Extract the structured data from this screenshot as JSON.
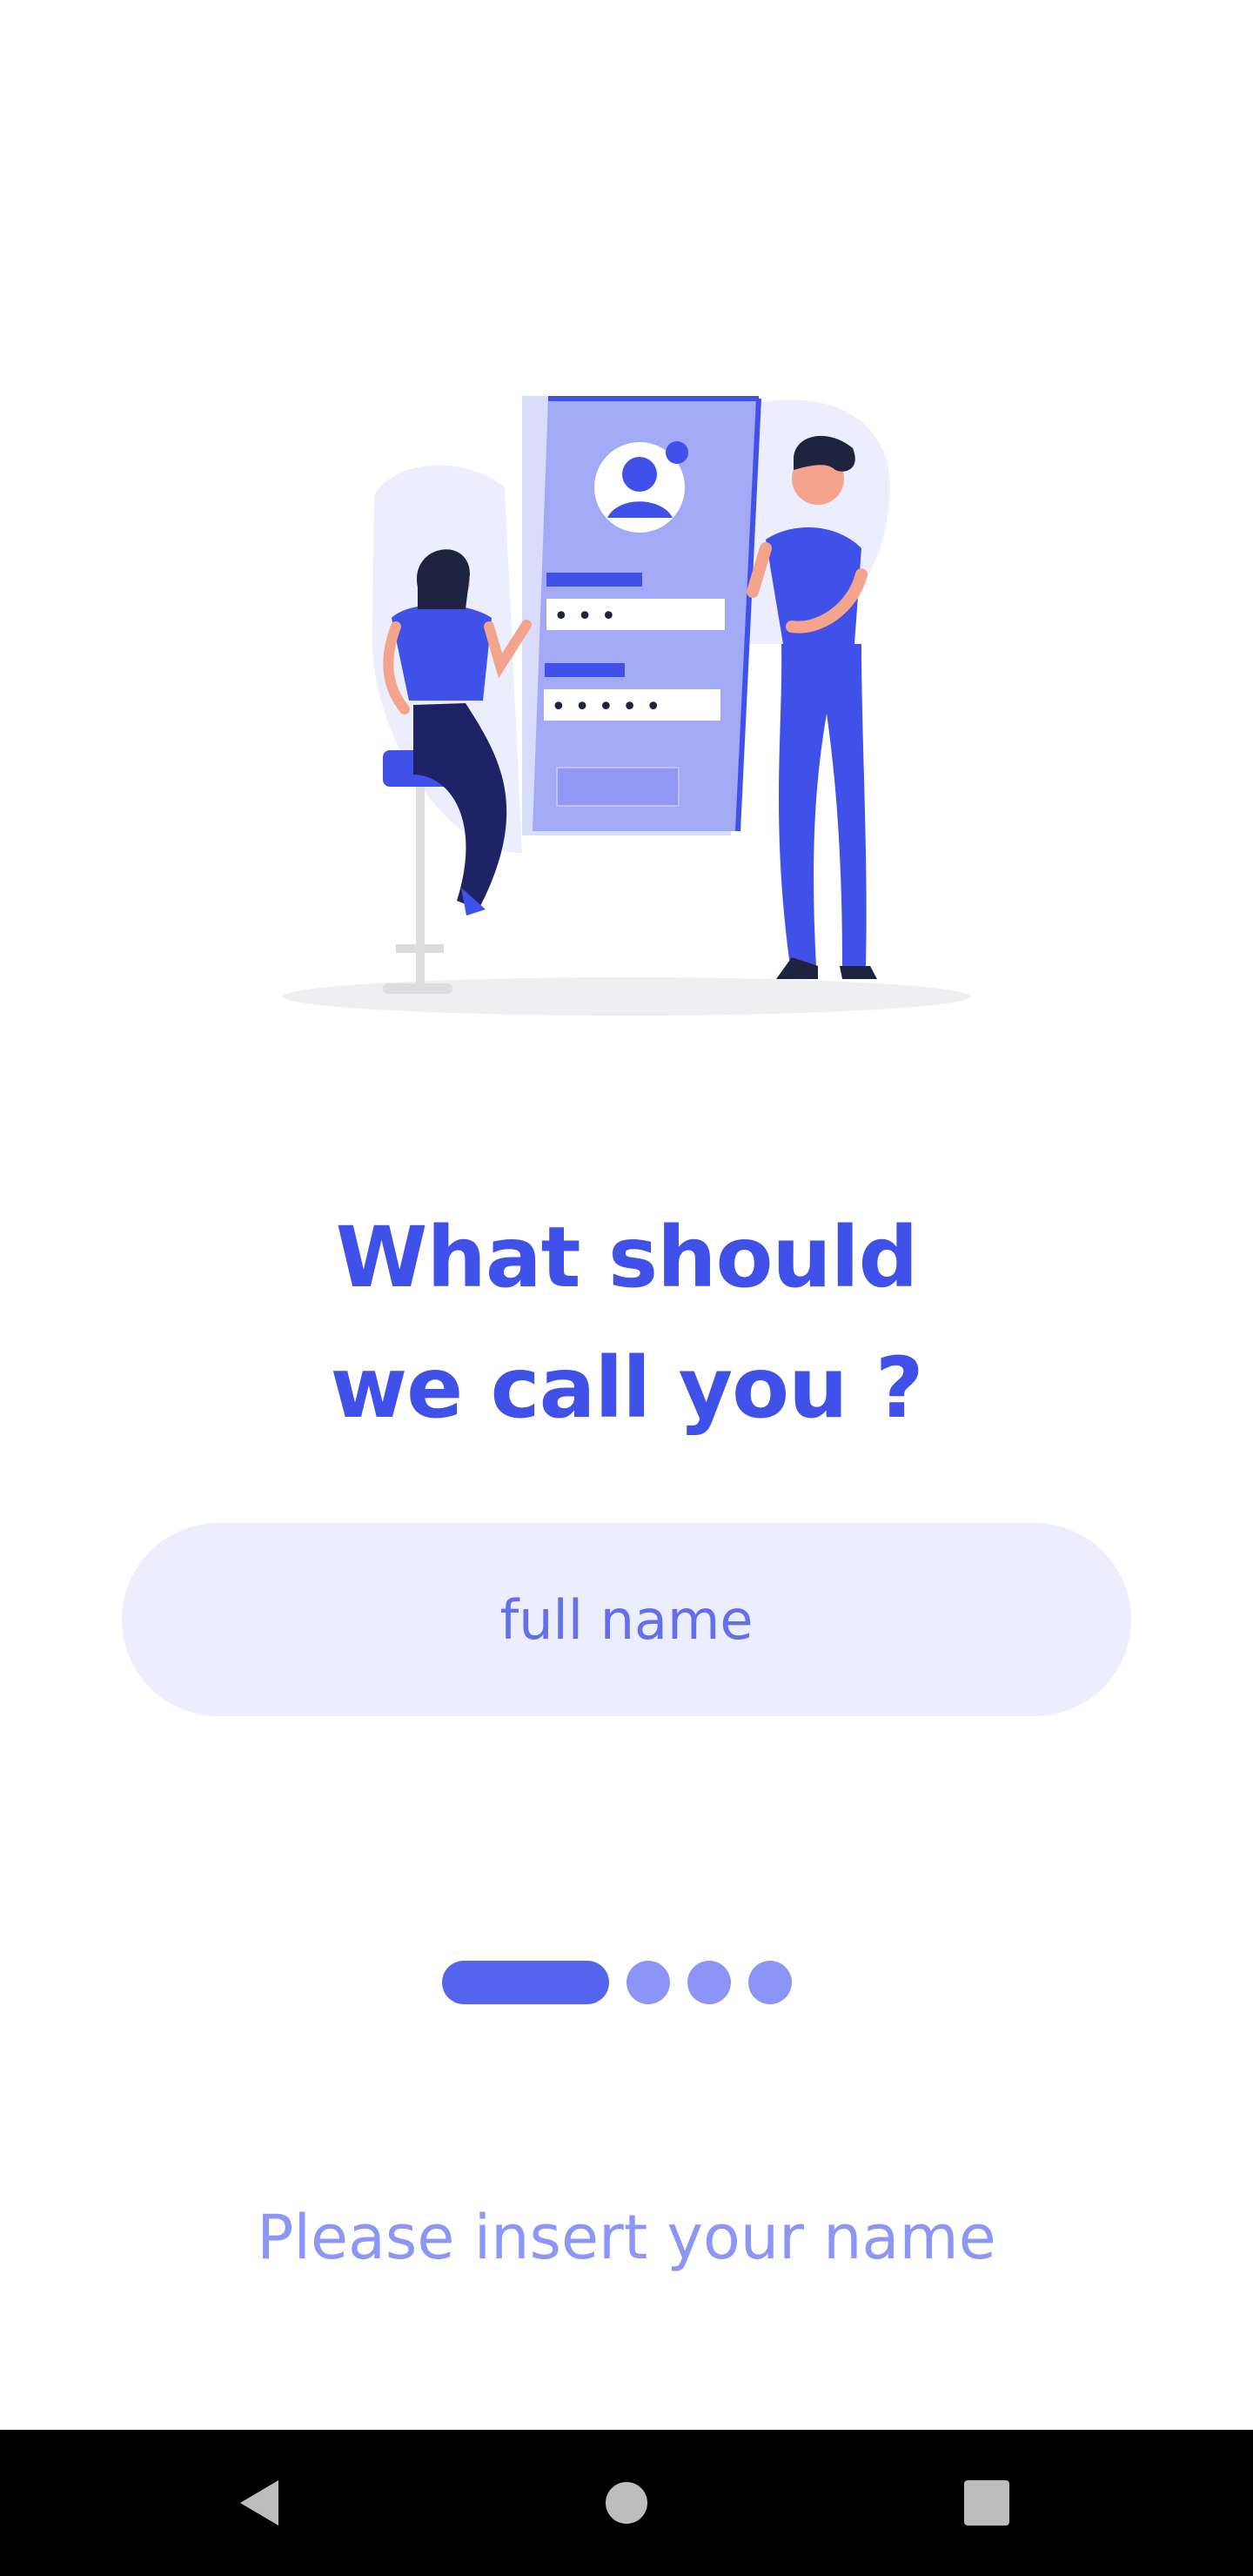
{
  "onboarding": {
    "title_line1": "What should",
    "title_line2": "we call you ?",
    "name_input": {
      "placeholder": "full name",
      "value": ""
    },
    "pager": {
      "current_step": 1,
      "total_steps": 4
    },
    "hint": "Please insert your name"
  },
  "illustration": {
    "icon": "login-illustration",
    "password_field_1_mask": "• • •",
    "password_field_2_mask": "• • • • •"
  },
  "system_nav": {
    "back_icon": "back-triangle-icon",
    "home_icon": "home-circle-icon",
    "recents_icon": "recents-square-icon"
  },
  "colors": {
    "accent": "#3f51e8",
    "input_bg": "#eceefd",
    "dot_inactive": "#8a95f5",
    "dot_active": "#5565ef",
    "hint": "#8c96f4"
  }
}
